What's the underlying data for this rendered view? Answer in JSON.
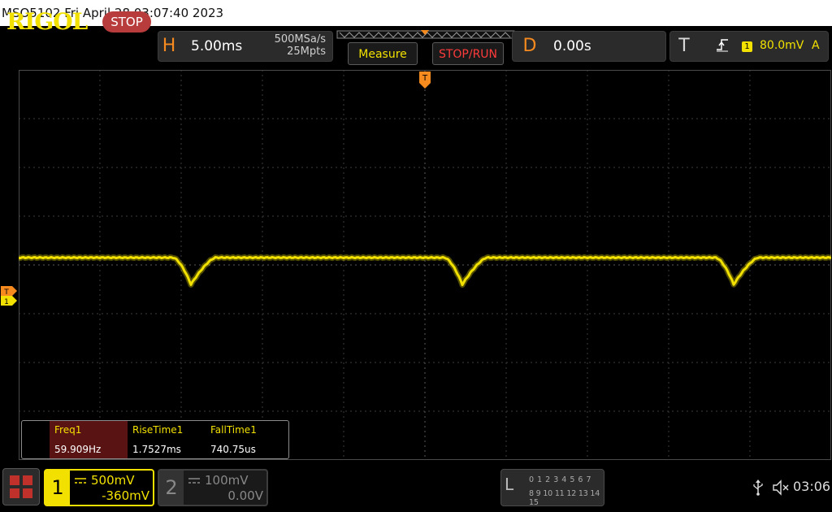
{
  "title_bar": {
    "text": "MSO5102  Fri April 28 03:07:40 2023"
  },
  "top_bar": {
    "logo": "RIGOL",
    "run_state": "STOP",
    "horizontal": {
      "letter": "H",
      "timebase": "5.00ms",
      "sample_rate": "500MSa/s",
      "memory_depth": "25Mpts"
    },
    "measure_button": "Measure",
    "stop_run_button": "STOP/RUN",
    "delay": {
      "letter": "D",
      "value": "0.00s"
    },
    "trigger": {
      "letter": "T",
      "source": "1",
      "level": "80.0mV",
      "mode": "A"
    }
  },
  "markers": {
    "trigger_position": "T",
    "trigger_level": "T",
    "ch1_offset": "1"
  },
  "measurements": [
    {
      "name": "Freq1",
      "value": "59.909Hz",
      "highlighted": true
    },
    {
      "name": "RiseTime1",
      "value": "1.7527ms",
      "highlighted": false
    },
    {
      "name": "FallTime1",
      "value": "740.75us",
      "highlighted": false
    }
  ],
  "channels": [
    {
      "number": "1",
      "scale": "500mV",
      "offset": "-360mV",
      "active": true,
      "color": "#f2e100"
    },
    {
      "number": "2",
      "scale": "100mV",
      "offset": "0.00V",
      "active": false,
      "color": "#888888"
    }
  ],
  "logic_analyzer": {
    "letter": "L",
    "row1": "0 1 2 3  4 5 6 7",
    "row2": "8 9 10 11 12 13 14 15"
  },
  "status": {
    "time": "03:06"
  },
  "colors": {
    "trace": "#f2e100",
    "accent_orange": "#f58a1f",
    "stop_red": "#b93c3c"
  }
}
